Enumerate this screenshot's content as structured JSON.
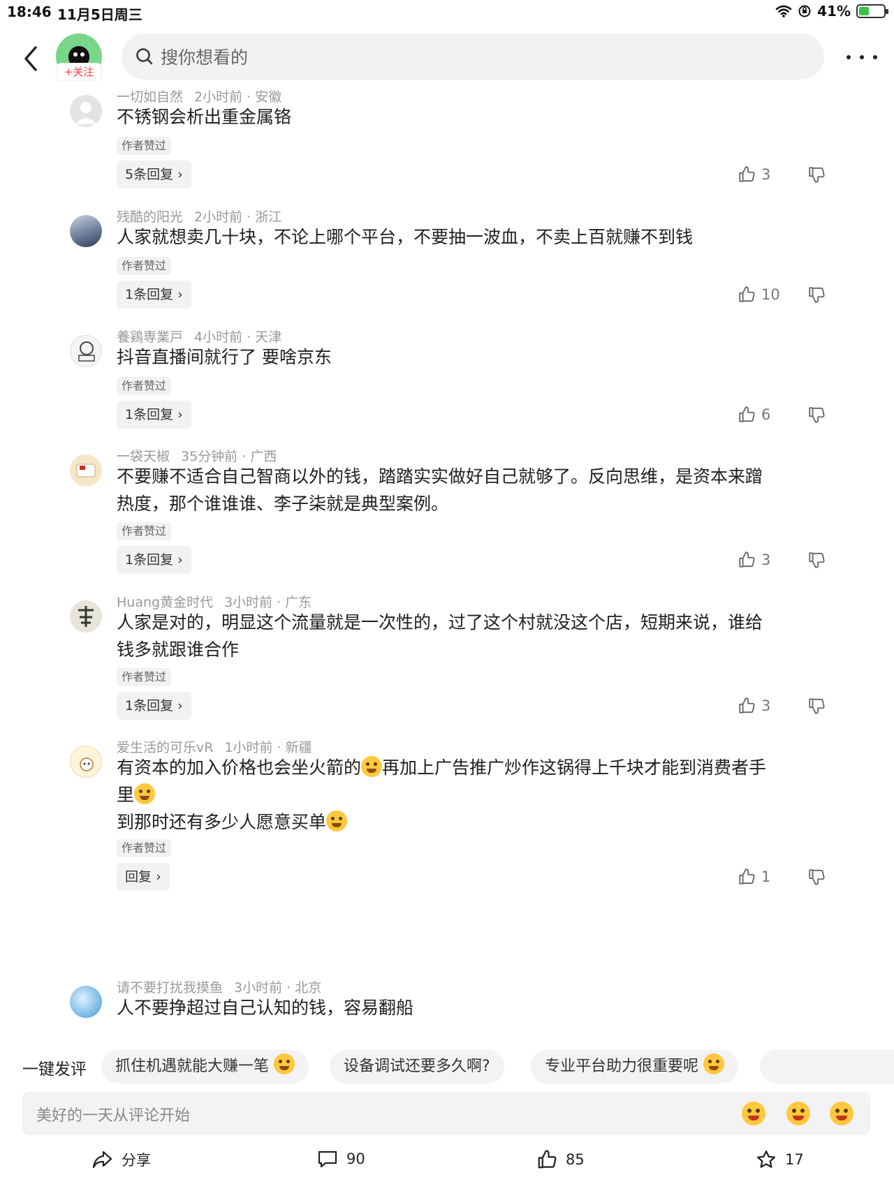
{
  "status_bar": {
    "time": "18:46",
    "date": "11月5日周三",
    "battery": "41%",
    "battery_level": 0.41
  },
  "header": {
    "follow_label": "+关注",
    "search_placeholder": "搜你想看的"
  },
  "comments": [
    {
      "user": "一切如自然",
      "time": "2小时前",
      "location": "安徽",
      "text": [
        "不锈钢会析出重金属铬"
      ],
      "tag": "作者赞过",
      "reply_label": "5条回复",
      "likes": "3"
    },
    {
      "user": "残酷的阳光",
      "time": "2小时前",
      "location": "浙江",
      "text": [
        "人家就想卖几十块，不论上哪个平台，不要抽一波血，不卖上百就赚不到钱"
      ],
      "tag": "作者赞过",
      "reply_label": "1条回复",
      "likes": "10"
    },
    {
      "user": "養鶏専業戸",
      "time": "4小时前",
      "location": "天津",
      "text": [
        "抖音直播间就行了 要啥京东"
      ],
      "tag": "作者赞过",
      "reply_label": "1条回复",
      "likes": "6"
    },
    {
      "user": "一袋天椒",
      "time": "35分钟前",
      "location": "广西",
      "text": [
        "不要赚不适合自己智商以外的钱，踏踏实实做好自己就够了。反向思维，是资本来蹭",
        "热度，那个谁谁谁、李子柒就是典型案例。"
      ],
      "tag": "作者赞过",
      "reply_label": "1条回复",
      "likes": "3"
    },
    {
      "user": "Huang黄金时代",
      "time": "3小时前",
      "location": "广东",
      "text": [
        "人家是对的，明显这个流量就是一次性的，过了这个村就没这个店，短期来说，谁给",
        "钱多就跟谁合作"
      ],
      "tag": "作者赞过",
      "reply_label": "1条回复",
      "likes": "3"
    },
    {
      "user": "爱生活的可乐vR",
      "time": "1小时前",
      "location": "新疆",
      "text": [
        "有资本的加入价格也会坐火箭的",
        "再加上广告推广炒作这锅得上千块才能到消费者手",
        "里",
        "到那时还有多少人愿意买单"
      ],
      "tag": "作者赞过",
      "reply_label": "回复",
      "likes": "1"
    },
    {
      "user": "请不要打扰我摸鱼",
      "time": "3小时前",
      "location": "北京",
      "text": [
        "人不要挣超过自己认知的钱，容易翻船"
      ]
    }
  ],
  "quick_comments": {
    "label": "一键发评",
    "chips": [
      "抓住机遇就能大赚一笔",
      "设备调试还要多久啊?",
      "专业平台助力很重要呢"
    ]
  },
  "comment_input": {
    "placeholder": "美好的一天从评论开始"
  },
  "actions": {
    "share": "分享",
    "comments": "90",
    "likes": "85",
    "favorites": "17"
  },
  "colors": {
    "accent": "#f04142",
    "muted_text": "#999999",
    "chip_bg": "#f3f3f5"
  },
  "icons": [
    "back-icon",
    "search-icon",
    "more-icon",
    "thumb-up-icon",
    "thumb-down-icon",
    "chevron-right-icon",
    "share-icon",
    "comment-icon",
    "star-icon"
  ]
}
